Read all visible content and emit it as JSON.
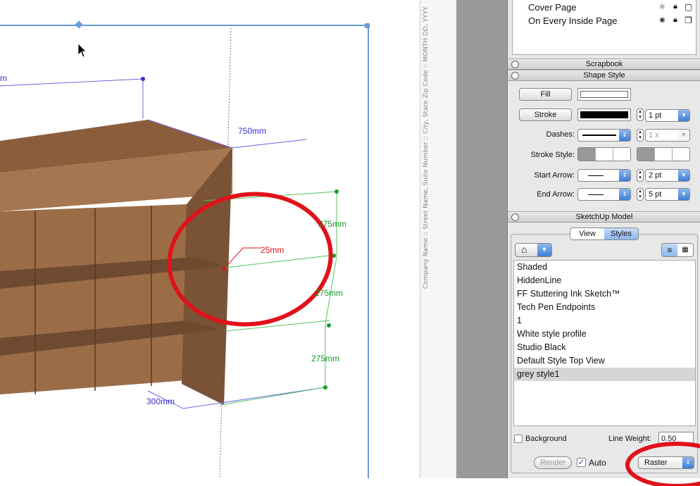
{
  "canvas": {
    "dimensions": [
      "750mm",
      "25mm",
      "275mm",
      "275mm",
      "275mm",
      "300mm"
    ],
    "margin_text": "Company Name  ::  Street Name, Suite Number  ::  City, State Zip Code  ::  MONTH DD, YYYY"
  },
  "layers": {
    "items": [
      {
        "label": "Cover Page"
      },
      {
        "label": "On Every Inside Page"
      }
    ]
  },
  "scrapbook": {
    "title": "Scrapbook"
  },
  "shape_style": {
    "title": "Shape Style",
    "fill_label": "Fill",
    "stroke_label": "Stroke",
    "stroke_width": "1 pt",
    "dashes_label": "Dashes:",
    "dash_scale": "1 x",
    "stroke_style_label": "Stroke Style:",
    "start_arrow_label": "Start Arrow:",
    "start_arrow_size": "2 pt",
    "end_arrow_label": "End Arrow:",
    "end_arrow_size": "5 pt"
  },
  "sketchup_model": {
    "title": "SketchUp Model",
    "tabs": [
      {
        "label": "View"
      },
      {
        "label": "Styles",
        "active": true
      }
    ],
    "styles": [
      "Shaded",
      "HiddenLine",
      "FF Stuttering Ink Sketch™",
      "Tech Pen Endpoints",
      " 1",
      "White style profile",
      "Studio Black",
      "Default Style Top View",
      "grey style1"
    ],
    "selected": "grey style1",
    "background_label": "Background",
    "background_checked": false,
    "line_weight_label": "Line Weight:",
    "line_weight": "0.50",
    "render_label": "Render",
    "auto_label": "Auto",
    "auto_checked": true,
    "render_mode": "Raster"
  },
  "colors": {
    "annotation_red": "#e0121a",
    "dim_blue": "#3a2fd0",
    "dim_green": "#1a9a2a",
    "selection_blue": "#6a9ad8"
  }
}
